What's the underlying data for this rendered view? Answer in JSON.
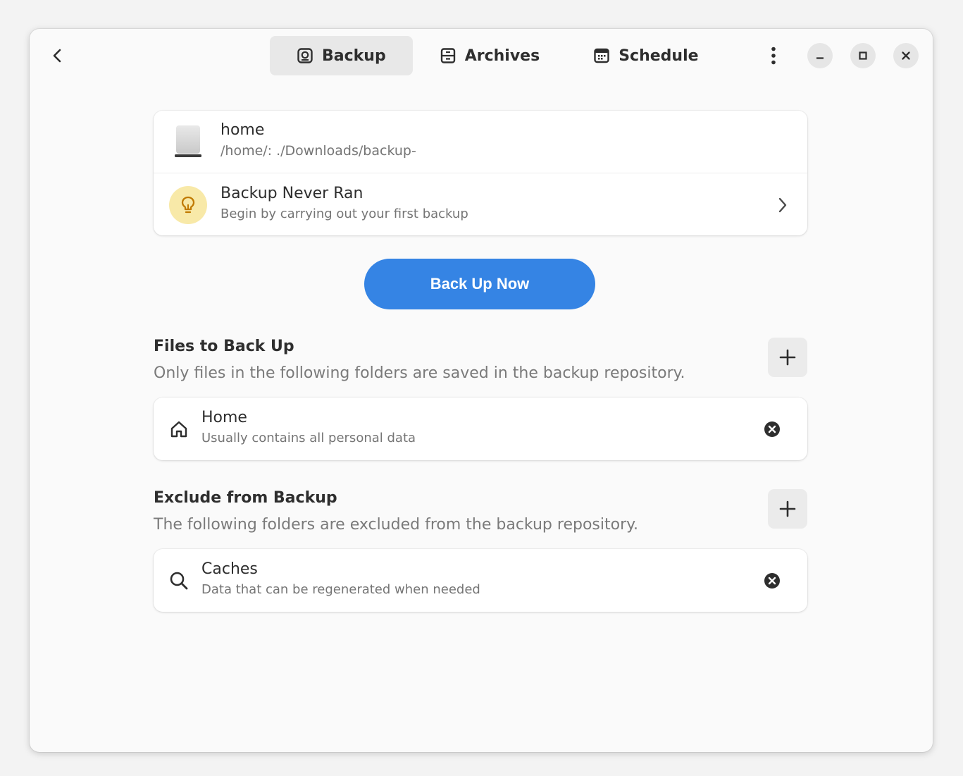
{
  "header": {
    "back_icon": "chevron-left-icon",
    "tabs": [
      {
        "label": "Backup",
        "icon": "backup-icon",
        "active": true
      },
      {
        "label": "Archives",
        "icon": "archives-icon",
        "active": false
      },
      {
        "label": "Schedule",
        "icon": "calendar-icon",
        "active": false
      }
    ],
    "menu_icon": "vertical-dots-icon",
    "window_controls": [
      "minimize-icon",
      "maximize-icon",
      "close-icon"
    ]
  },
  "repository": {
    "title": "home",
    "path": "/home/:    ./Downloads/backup-",
    "icon": "drive-icon"
  },
  "status": {
    "title": "Backup Never Ran",
    "subtitle": "Begin by carrying out your first backup",
    "icon": "lightbulb-icon",
    "icon_bg": "#f8e9a8"
  },
  "primary_button": {
    "label": "Back Up Now",
    "color": "#3584e4"
  },
  "include": {
    "title": "Files to Back Up",
    "description": "Only files in the following folders are saved in the backup repository.",
    "items": [
      {
        "title": "Home",
        "subtitle": "Usually contains all personal data",
        "icon": "home-icon"
      }
    ]
  },
  "exclude": {
    "title": "Exclude from Backup",
    "description": "The following folders are excluded from the backup repository.",
    "items": [
      {
        "title": "Caches",
        "subtitle": "Data that can be regenerated when needed",
        "icon": "search-icon"
      }
    ]
  }
}
